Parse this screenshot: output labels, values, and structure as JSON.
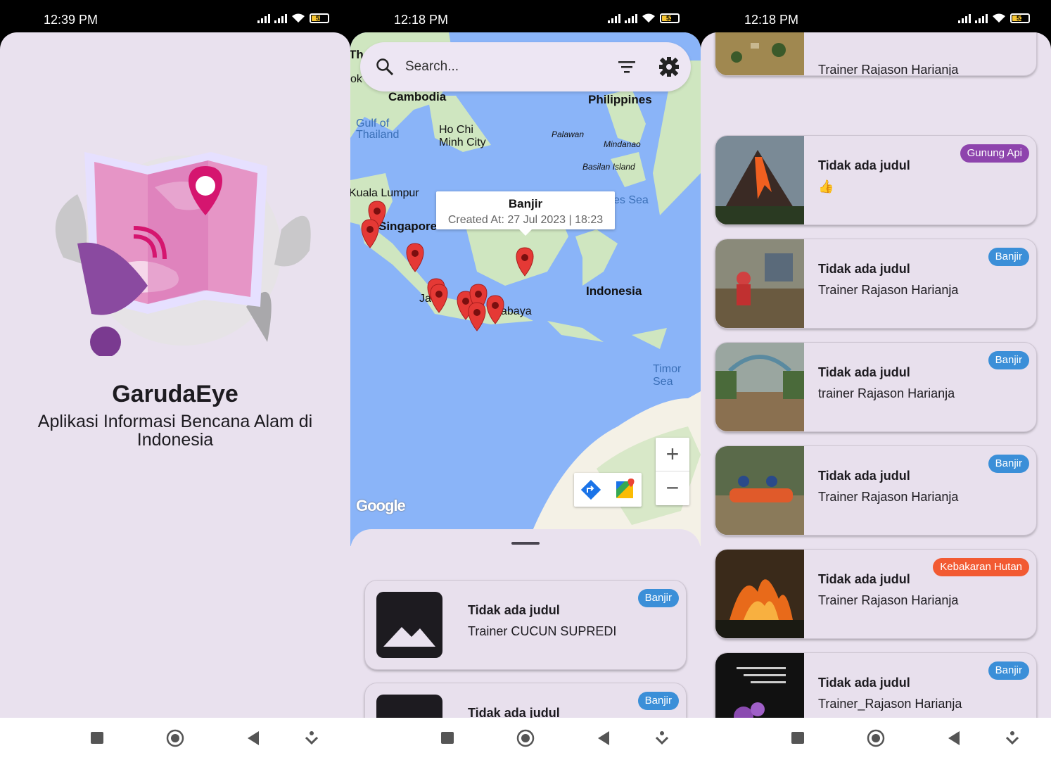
{
  "panels": [
    {
      "status": {
        "time": "12:39 PM",
        "battery": "52"
      },
      "splash": {
        "app_name": "GarudaEye",
        "subtitle": "Aplikasi Informasi Bencana Alam di Indonesia"
      }
    },
    {
      "status": {
        "time": "12:18 PM",
        "battery": "53"
      },
      "search": {
        "placeholder": "Search..."
      },
      "map": {
        "labels": {
          "cambodia": "Cambodia",
          "philippines": "Philippines",
          "gulf": "Gulf of Thailand",
          "hochiminh": "Ho Chi Minh City",
          "palawan": "Palawan",
          "mindanao": "Mindanao",
          "basilan": "Basilan Island",
          "kl": "Kuala Lumpur",
          "singapore": "Singapore",
          "sea": "es Sea",
          "indonesia": "Indonesia",
          "jakarta": "Ja",
          "surabaya": "abaya",
          "timor": "Timor Sea",
          "th": "Th",
          "ok": "ok",
          "google": "Google"
        },
        "infowindow": {
          "title": "Banjir",
          "created": "Created At: 27 Jul 2023 | 18:23"
        },
        "zoom_in": "+",
        "zoom_out": "−"
      },
      "cards": [
        {
          "title": "Tidak ada judul",
          "subtitle": "Trainer CUCUN SUPREDI",
          "badge": "Banjir"
        },
        {
          "title": "Tidak ada judul",
          "subtitle": "",
          "badge": "Banjir"
        }
      ]
    },
    {
      "status": {
        "time": "12:18 PM",
        "battery": "53"
      },
      "cards": [
        {
          "title": "",
          "subtitle": "Trainer Rajason Harianja",
          "badge": ""
        },
        {
          "title": "Tidak ada judul",
          "subtitle": "👍",
          "badge": "Gunung Api"
        },
        {
          "title": "Tidak ada judul",
          "subtitle": "Trainer Rajason Harianja",
          "badge": "Banjir"
        },
        {
          "title": "Tidak ada judul",
          "subtitle": "trainer Rajason Harianja",
          "badge": "Banjir"
        },
        {
          "title": "Tidak ada judul",
          "subtitle": "Trainer Rajason Harianja",
          "badge": "Banjir"
        },
        {
          "title": "Tidak ada judul",
          "subtitle": "Trainer Rajason Harianja",
          "badge": "Kebakaran Hutan"
        },
        {
          "title": "Tidak ada judul",
          "subtitle": "Trainer_Rajason Harianja",
          "badge": "Banjir"
        }
      ]
    }
  ],
  "colors": {
    "background": "#e9e1ee",
    "badge_banjir": "#3b8fd8",
    "badge_gunung_api": "#8e44ad",
    "badge_kebakaran": "#f25a32",
    "marker": "#e53935",
    "sea": "#8ab4f8",
    "land": "#cfe6c0"
  },
  "icons": [
    "search-icon",
    "filter-icon",
    "settings-icon",
    "map-marker-icon",
    "image-placeholder-icon",
    "directions-icon",
    "google-maps-icon",
    "square-nav-icon",
    "circle-nav-icon",
    "back-nav-icon",
    "down-nav-icon"
  ]
}
